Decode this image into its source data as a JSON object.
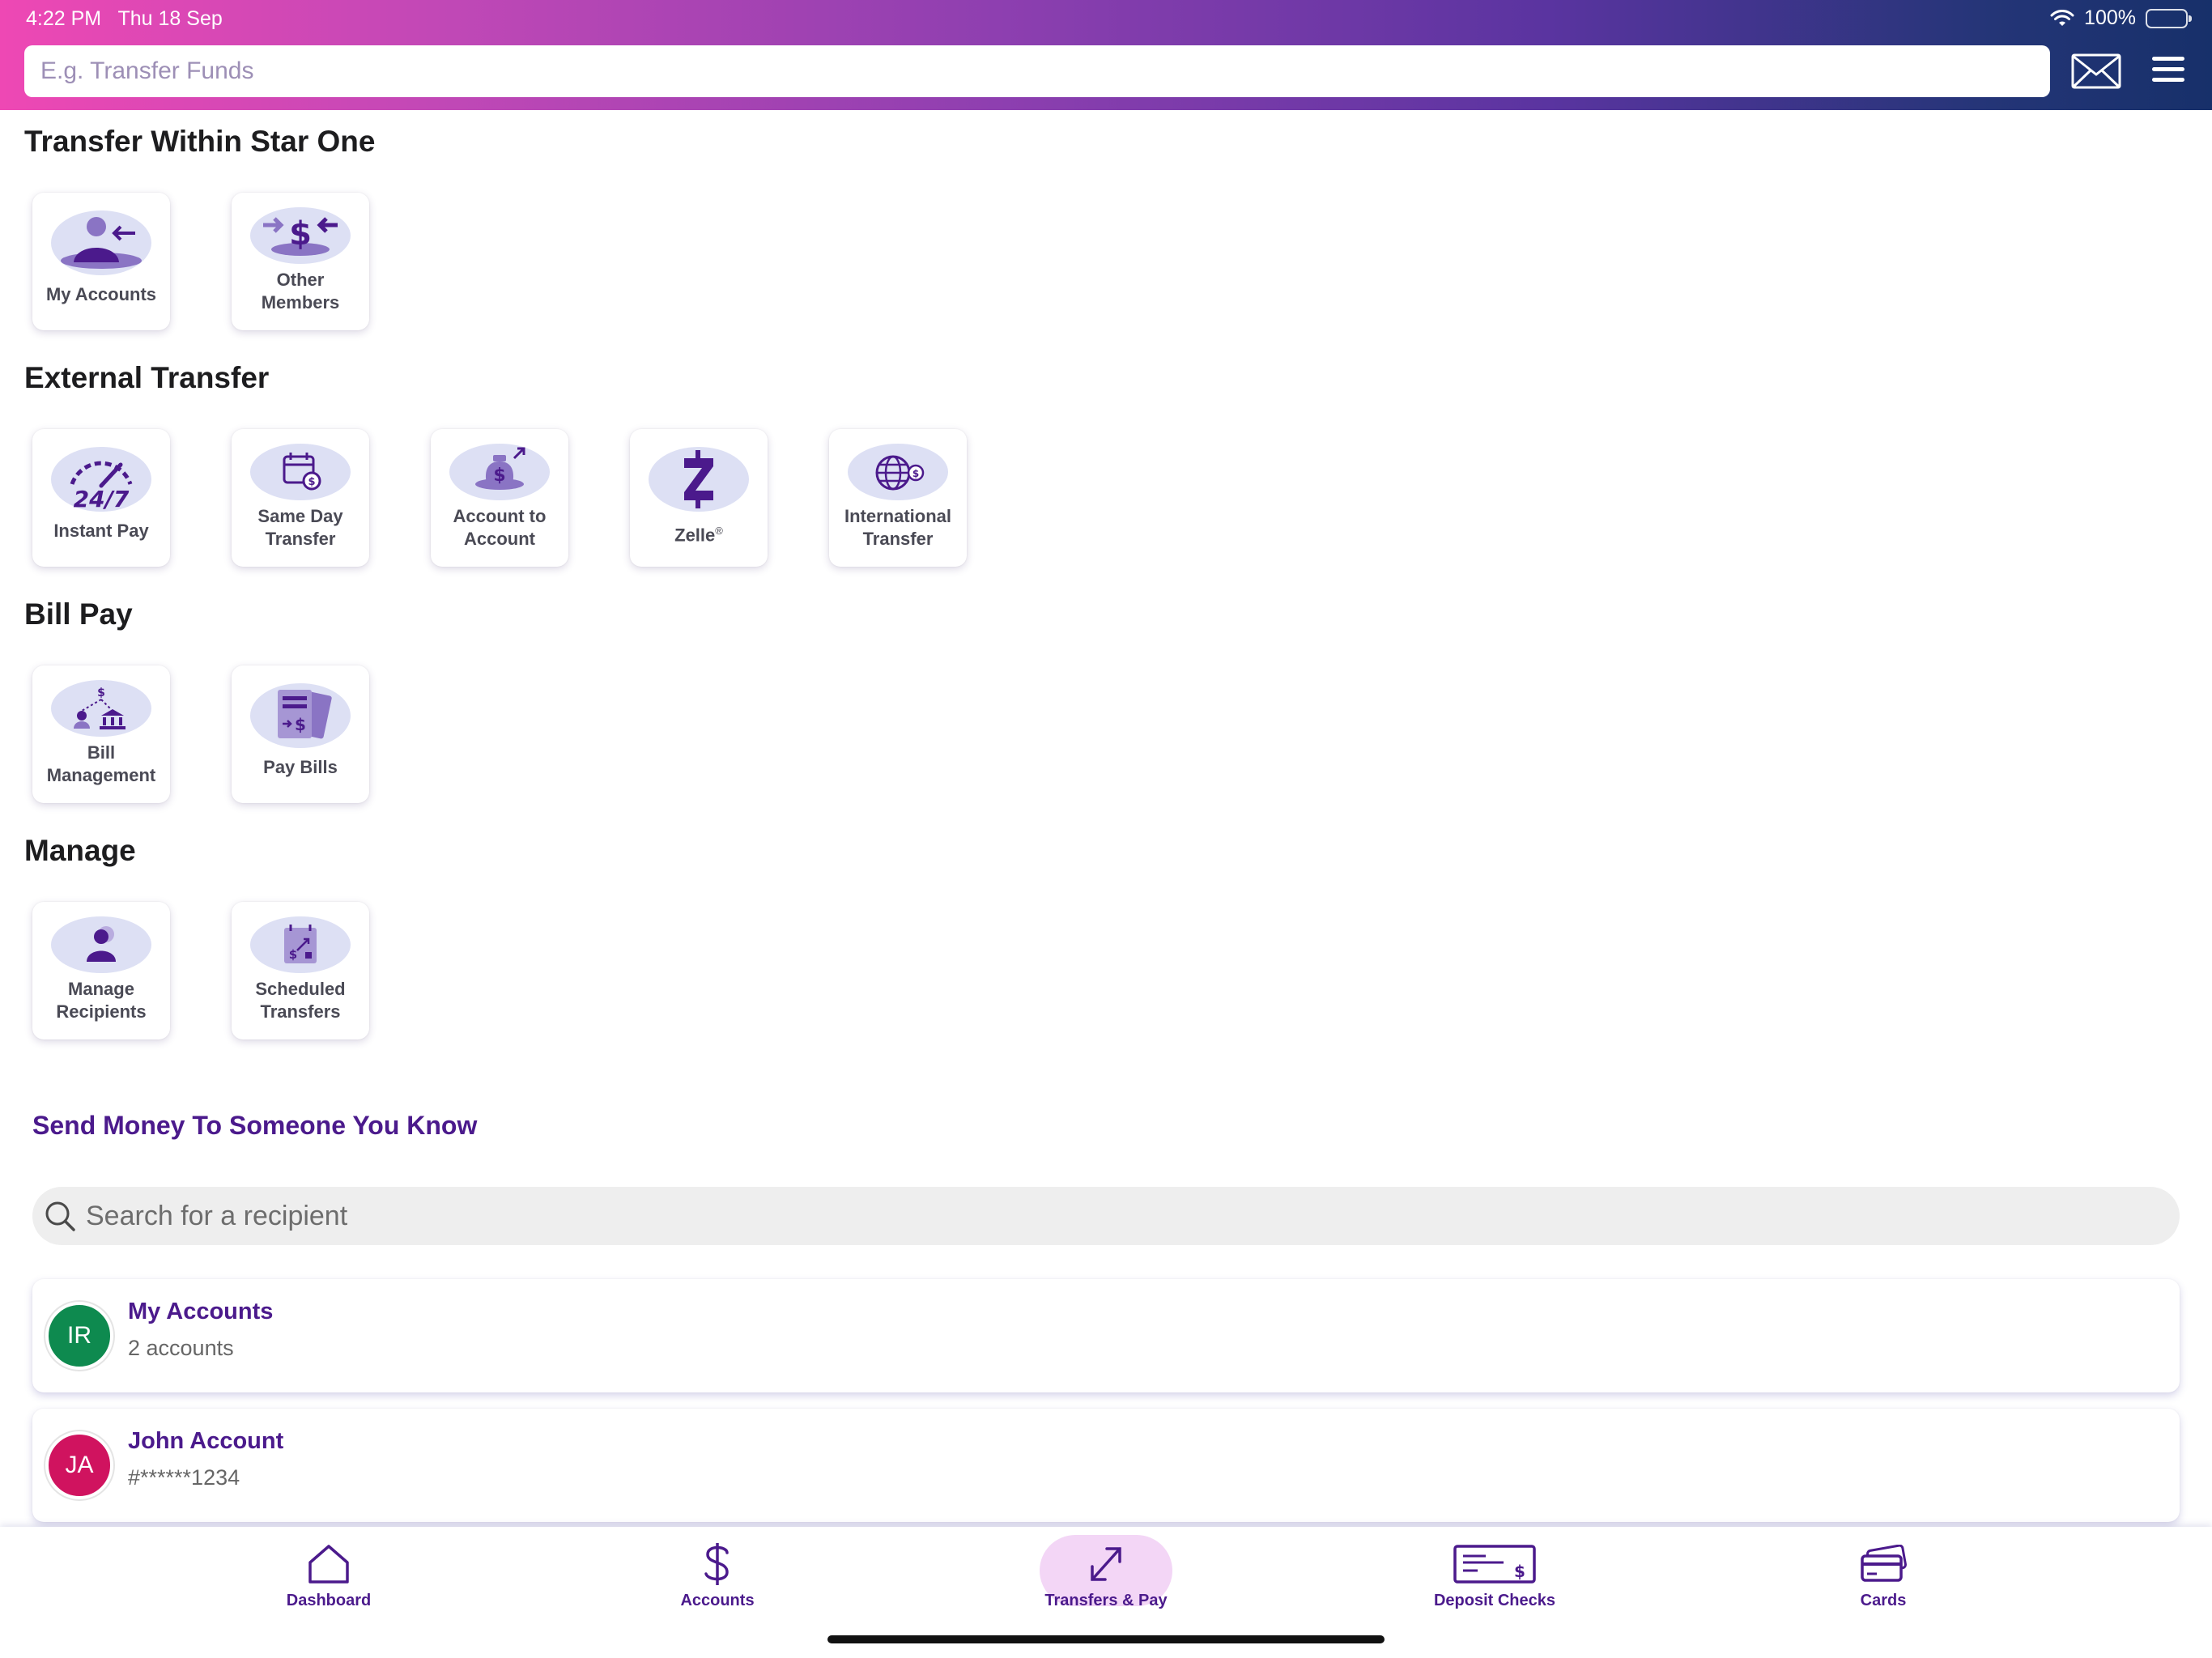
{
  "status_bar": {
    "time": "4:22 PM",
    "date": "Thu 18 Sep",
    "battery": "100%"
  },
  "header": {
    "search_placeholder": "E.g. Transfer Funds"
  },
  "sections": {
    "within": {
      "title": "Transfer Within Star One",
      "items": [
        {
          "label": "My Accounts",
          "icon": "person-arrow-icon"
        },
        {
          "label": "Other Members",
          "icon": "dollar-arrows-icon"
        }
      ]
    },
    "external": {
      "title": "External Transfer",
      "items": [
        {
          "label": "Instant Pay",
          "icon": "speedometer-247-icon"
        },
        {
          "label": "Same Day Transfer",
          "icon": "calendar-dollar-icon"
        },
        {
          "label": "Account to Account",
          "icon": "money-bag-arrow-icon"
        },
        {
          "label": "Zelle",
          "trademark": "®",
          "icon": "zelle-icon"
        },
        {
          "label": "International Transfer",
          "icon": "globe-dollar-icon"
        }
      ]
    },
    "billpay": {
      "title": "Bill Pay",
      "items": [
        {
          "label": "Bill Management",
          "icon": "bank-people-icon"
        },
        {
          "label": "Pay Bills",
          "icon": "bill-dollar-icon"
        }
      ]
    },
    "manage": {
      "title": "Manage",
      "items": [
        {
          "label": "Manage Recipients",
          "icon": "person-icon"
        },
        {
          "label": "Scheduled Transfers",
          "icon": "calendar-transfer-icon"
        }
      ]
    }
  },
  "send_money": {
    "title": "Send Money To Someone You Know",
    "search_placeholder": "Search for a recipient",
    "recipients": [
      {
        "initials": "IR",
        "name": "My Accounts",
        "detail": "2 accounts",
        "color": "#0e8a4f"
      },
      {
        "initials": "JA",
        "name": "John Account",
        "detail": "#******1234",
        "color": "#d0135f"
      }
    ]
  },
  "tabs": [
    {
      "label": "Dashboard",
      "icon": "home-icon"
    },
    {
      "label": "Accounts",
      "icon": "dollar-icon"
    },
    {
      "label": "Transfers & Pay",
      "icon": "transfer-arrows-icon",
      "active": true
    },
    {
      "label": "Deposit Checks",
      "icon": "check-icon"
    },
    {
      "label": "Cards",
      "icon": "cards-icon"
    }
  ],
  "colors": {
    "brand_purple": "#4b1a8c",
    "icon_bg": "#dde0f4",
    "active_tab_bg": "#f3d6f6"
  }
}
